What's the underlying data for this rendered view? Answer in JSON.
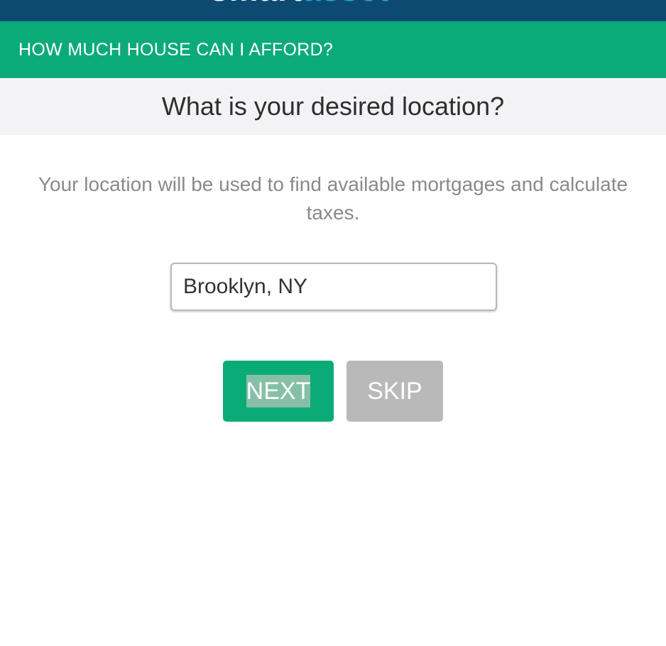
{
  "header": {
    "logo_part_a": "smart",
    "logo_part_b": "asset",
    "menu_icon": "hamburger-menu-icon",
    "colors": {
      "header_bg": "#0d4a72",
      "logo_accent": "#29a8e0"
    }
  },
  "calculator": {
    "title": "HOW MUCH HOUSE CAN I AFFORD?",
    "title_bg": "#0bab77"
  },
  "question": {
    "text": "What is your desired location?"
  },
  "description": {
    "text": "Your location will be used to find available mortgages and calculate taxes."
  },
  "location_input": {
    "value": "Brooklyn, NY"
  },
  "actions": {
    "next_label": "NEXT",
    "skip_label": "SKIP",
    "next_color": "#0bab77",
    "skip_color": "#b9b9b9"
  }
}
